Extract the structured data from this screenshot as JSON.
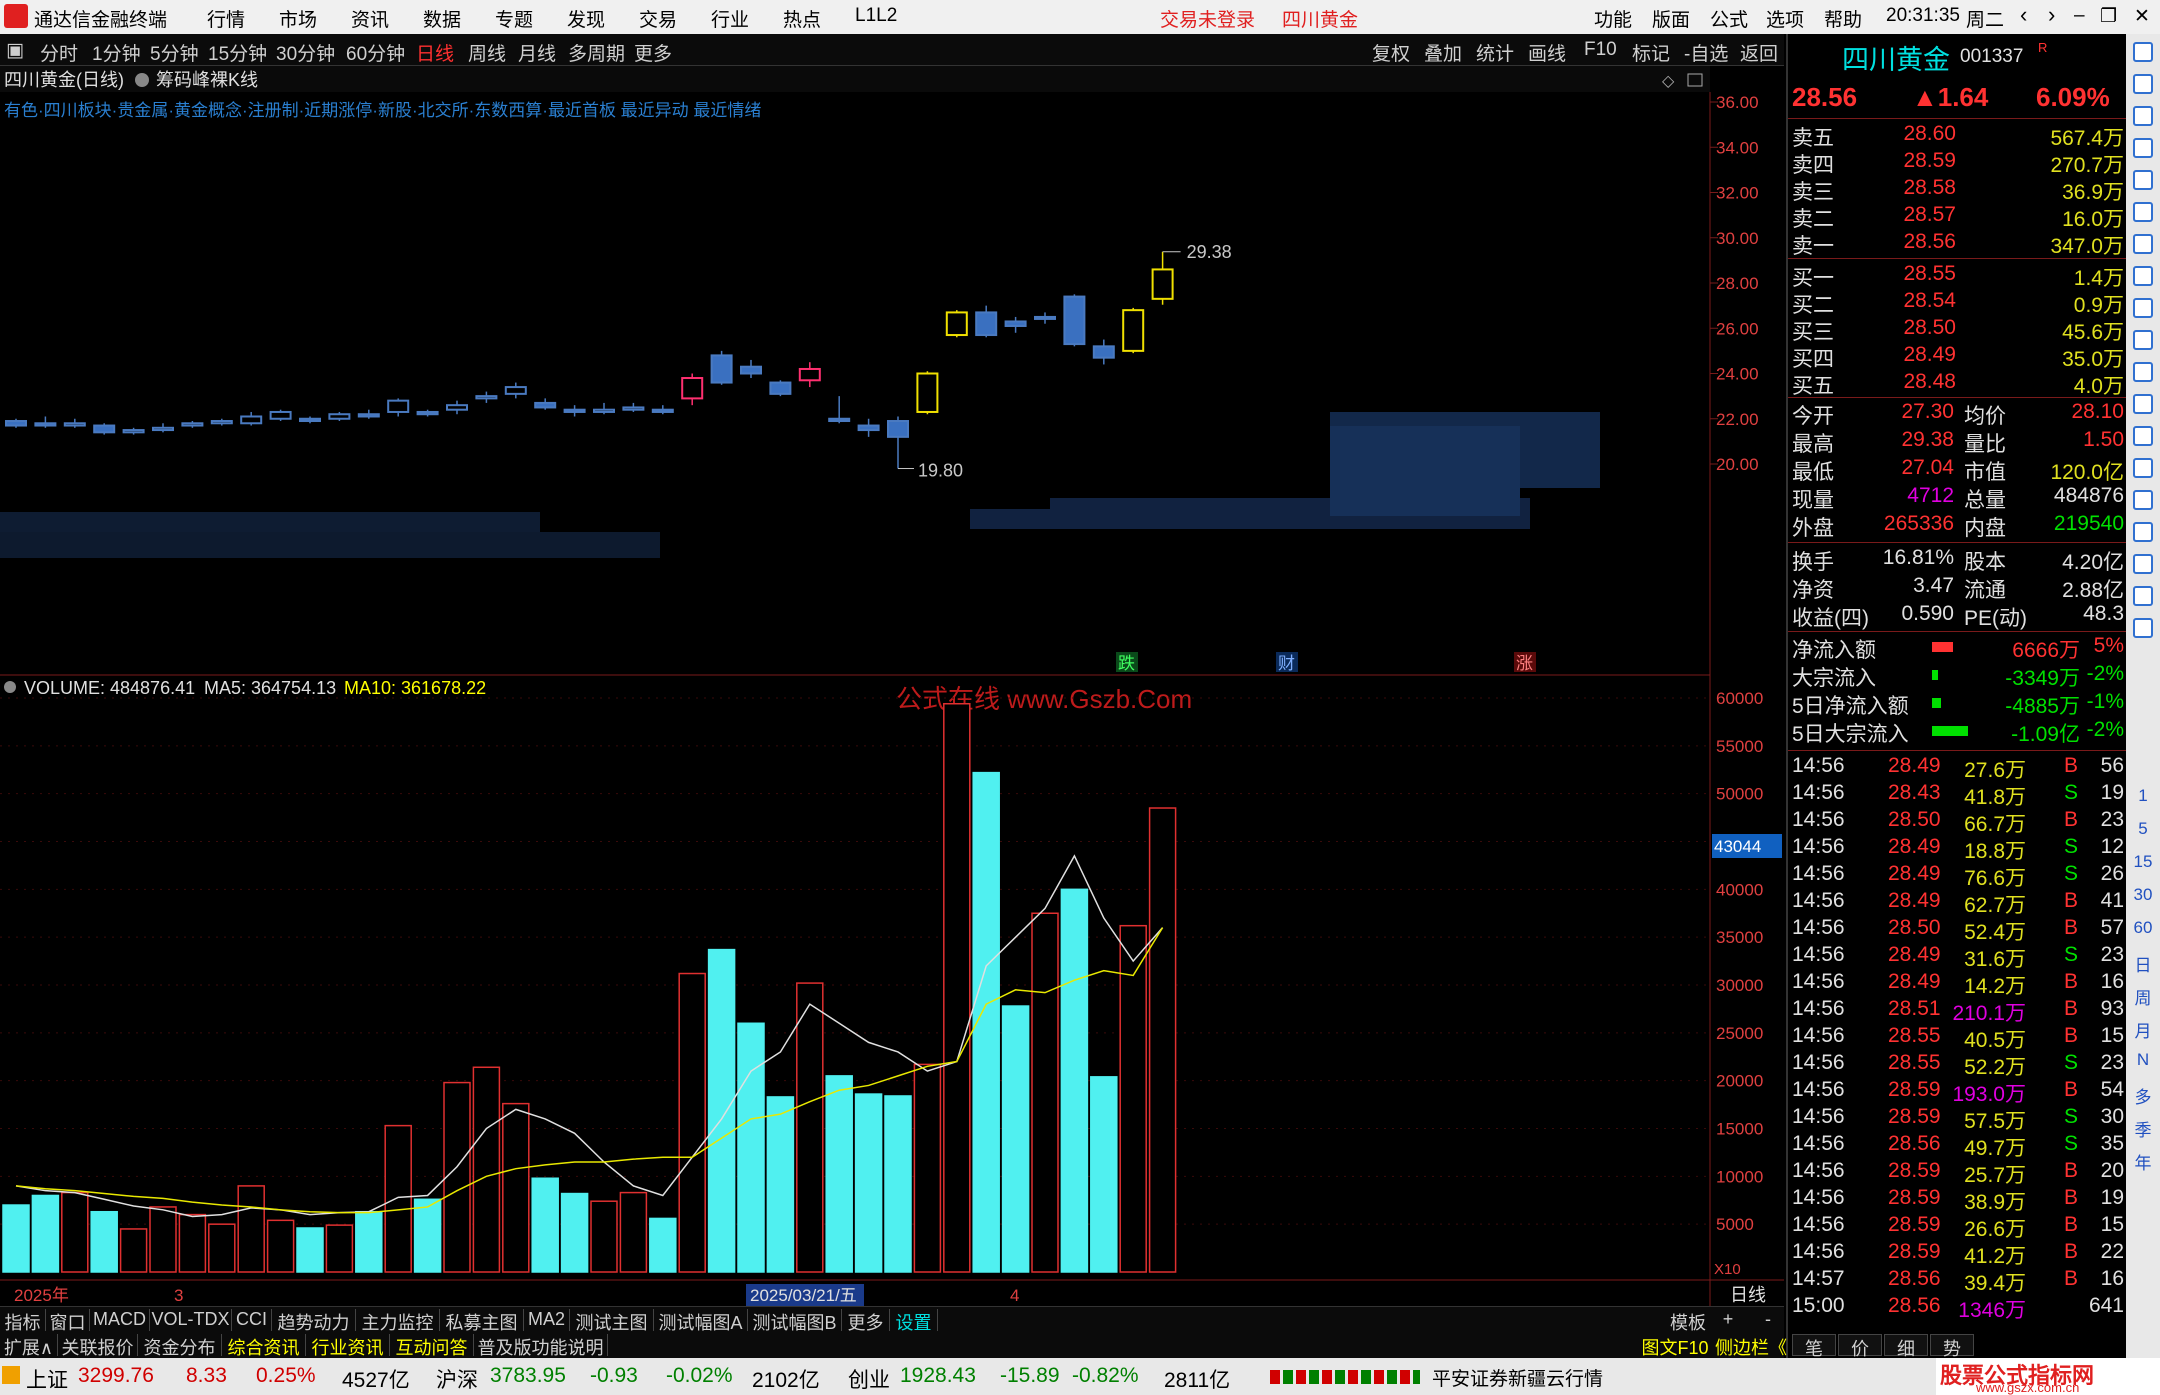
{
  "menubar": {
    "app_title": "通达信金融终端",
    "items": [
      "行情",
      "市场",
      "资讯",
      "数据",
      "专题",
      "发现",
      "交易",
      "行业",
      "热点",
      "L1L2"
    ],
    "login_status": "交易未登录",
    "stock_name": "四川黄金",
    "right_items": [
      "功能",
      "版面",
      "公式",
      "选项",
      "帮助"
    ],
    "time": "20:31:35",
    "weekday": "周二"
  },
  "toolbar": {
    "periods": [
      "分时",
      "1分钟",
      "5分钟",
      "15分钟",
      "30分钟",
      "60分钟",
      "日线",
      "周线",
      "月线",
      "多周期",
      "更多"
    ],
    "active_period": "日线",
    "right_buttons": [
      "复权",
      "叠加",
      "统计",
      "画线",
      "F10",
      "标记",
      "-自选",
      "返回"
    ]
  },
  "chart_header": {
    "title": "四川黄金(日线)",
    "indicator": "筹码峰裸K线",
    "info_line": "有色·四川板块·贵金属·黄金概念·注册制·近期涨停·新股·北交所·东数西算·最近首板 最近异动 最近情绪"
  },
  "price_axis": [
    "36.00",
    "34.00",
    "32.00",
    "30.00",
    "28.00",
    "26.00",
    "24.00",
    "22.00",
    "20.00"
  ],
  "annotations": {
    "high_label": "29.38",
    "low_label": "19.80",
    "marks": [
      "跌",
      "财",
      "涨"
    ]
  },
  "volume_header": {
    "volume": "VOLUME: 484876.41",
    "ma5": "MA5: 364754.13",
    "ma10": "MA10: 361678.22"
  },
  "volume_axis": [
    "60000",
    "55000",
    "50000",
    "45000",
    "40000",
    "35000",
    "30000",
    "25000",
    "20000",
    "15000",
    "10000",
    "5000"
  ],
  "volume_marker": "43044",
  "volume_unit": "X10",
  "watermark": "公式在线 www.Gszb.Com",
  "xaxis": {
    "year": "2025年",
    "month3": "3",
    "date_box": "2025/03/21/五",
    "month4": "4",
    "period_label": "日线"
  },
  "chart_data": {
    "type": "candlestick+bar",
    "candles": [
      {
        "o": 21.9,
        "c": 21.7,
        "h": 22.0,
        "l": 21.6
      },
      {
        "o": 21.8,
        "c": 21.7,
        "h": 22.1,
        "l": 21.6
      },
      {
        "o": 21.7,
        "c": 21.8,
        "h": 22.0,
        "l": 21.6
      },
      {
        "o": 21.7,
        "c": 21.4,
        "h": 21.8,
        "l": 21.3
      },
      {
        "o": 21.4,
        "c": 21.5,
        "h": 21.6,
        "l": 21.3
      },
      {
        "o": 21.5,
        "c": 21.6,
        "h": 21.8,
        "l": 21.4
      },
      {
        "o": 21.7,
        "c": 21.8,
        "h": 21.9,
        "l": 21.6
      },
      {
        "o": 21.8,
        "c": 21.9,
        "h": 22.0,
        "l": 21.7
      },
      {
        "o": 21.8,
        "c": 22.1,
        "h": 22.3,
        "l": 21.7
      },
      {
        "o": 22.0,
        "c": 22.3,
        "h": 22.4,
        "l": 21.9
      },
      {
        "o": 22.0,
        "c": 21.9,
        "h": 22.1,
        "l": 21.8
      },
      {
        "o": 22.0,
        "c": 22.2,
        "h": 22.3,
        "l": 21.9
      },
      {
        "o": 22.2,
        "c": 22.1,
        "h": 22.4,
        "l": 22.0
      },
      {
        "o": 22.3,
        "c": 22.8,
        "h": 22.9,
        "l": 22.1
      },
      {
        "o": 22.3,
        "c": 22.2,
        "h": 22.4,
        "l": 22.1
      },
      {
        "o": 22.4,
        "c": 22.6,
        "h": 22.8,
        "l": 22.2
      },
      {
        "o": 22.9,
        "c": 23.0,
        "h": 23.2,
        "l": 22.7
      },
      {
        "o": 23.1,
        "c": 23.4,
        "h": 23.6,
        "l": 22.9
      },
      {
        "o": 22.7,
        "c": 22.5,
        "h": 22.9,
        "l": 22.4
      },
      {
        "o": 22.4,
        "c": 22.3,
        "h": 22.6,
        "l": 22.1
      },
      {
        "o": 22.3,
        "c": 22.4,
        "h": 22.7,
        "l": 22.2
      },
      {
        "o": 22.4,
        "c": 22.5,
        "h": 22.7,
        "l": 22.3
      },
      {
        "o": 22.4,
        "c": 22.3,
        "h": 22.6,
        "l": 22.2
      },
      {
        "o": 22.9,
        "c": 23.8,
        "h": 24.0,
        "l": 22.6
      },
      {
        "o": 24.8,
        "c": 23.6,
        "h": 25.0,
        "l": 23.5
      },
      {
        "o": 24.3,
        "c": 24.0,
        "h": 24.6,
        "l": 23.8
      },
      {
        "o": 23.6,
        "c": 23.1,
        "h": 23.7,
        "l": 23.0
      },
      {
        "o": 23.7,
        "c": 24.2,
        "h": 24.5,
        "l": 23.4
      },
      {
        "o": 22.0,
        "c": 21.9,
        "h": 23.0,
        "l": 21.8
      },
      {
        "o": 21.7,
        "c": 21.5,
        "h": 22.0,
        "l": 21.2
      },
      {
        "o": 21.9,
        "c": 21.2,
        "h": 22.1,
        "l": 19.8
      },
      {
        "o": 22.3,
        "c": 24.0,
        "h": 24.1,
        "l": 22.2
      },
      {
        "o": 25.7,
        "c": 26.7,
        "h": 26.8,
        "l": 25.6
      },
      {
        "o": 26.7,
        "c": 25.7,
        "h": 27.0,
        "l": 25.6
      },
      {
        "o": 26.3,
        "c": 26.1,
        "h": 26.5,
        "l": 25.8
      },
      {
        "o": 26.5,
        "c": 26.5,
        "h": 26.7,
        "l": 26.2
      },
      {
        "o": 27.4,
        "c": 25.3,
        "h": 27.5,
        "l": 25.2
      },
      {
        "o": 25.2,
        "c": 24.7,
        "h": 25.5,
        "l": 24.4
      },
      {
        "o": 25.0,
        "c": 26.8,
        "h": 26.9,
        "l": 24.9
      },
      {
        "o": 27.3,
        "c": 28.6,
        "h": 29.38,
        "l": 27.04
      }
    ],
    "volumes": [
      7000,
      8000,
      8300,
      6300,
      4500,
      6800,
      6000,
      5000,
      9000,
      5400,
      4600,
      4900,
      6300,
      15300,
      7600,
      19800,
      21400,
      17600,
      9800,
      8200,
      7400,
      8300,
      5600,
      31200,
      33700,
      26000,
      18300,
      30200,
      20500,
      18600,
      18400,
      21700,
      59400,
      52200,
      27800,
      37500,
      40000,
      20400,
      36200,
      48500
    ],
    "ma5": [
      9000,
      8500,
      8300,
      7600,
      6900,
      6500,
      5800,
      6000,
      6700,
      6500,
      6000,
      6200,
      6300,
      7800,
      8000,
      11000,
      15000,
      17000,
      16000,
      14500,
      11500,
      9000,
      8000,
      12000,
      16000,
      21000,
      23000,
      28000,
      26000,
      24000,
      23000,
      21000,
      22000,
      32000,
      35000,
      38000,
      43500,
      37000,
      32500,
      36000
    ],
    "ma10": [
      9000,
      8700,
      8500,
      8200,
      7900,
      7700,
      7300,
      7000,
      6800,
      6500,
      6300,
      6200,
      6200,
      6500,
      6800,
      8500,
      10000,
      10800,
      11200,
      11500,
      11500,
      11800,
      12000,
      12000,
      14000,
      16000,
      16500,
      17800,
      19000,
      19500,
      20500,
      21500,
      22000,
      28000,
      29500,
      29200,
      30500,
      31500,
      31000,
      36000
    ],
    "ylim_price": [
      19.5,
      37.0
    ],
    "ylim_volume": [
      0,
      62000
    ]
  },
  "quote": {
    "name": "四川黄金",
    "code": "001337",
    "price": "28.56",
    "change": "▲1.64",
    "pct": "6.09%",
    "sells": [
      {
        "label": "卖五",
        "price": "28.60",
        "vol": "567.4万"
      },
      {
        "label": "卖四",
        "price": "28.59",
        "vol": "270.7万"
      },
      {
        "label": "卖三",
        "price": "28.58",
        "vol": "36.9万"
      },
      {
        "label": "卖二",
        "price": "28.57",
        "vol": "16.0万"
      },
      {
        "label": "卖一",
        "price": "28.56",
        "vol": "347.0万"
      }
    ],
    "buys": [
      {
        "label": "买一",
        "price": "28.55",
        "vol": "1.4万"
      },
      {
        "label": "买二",
        "price": "28.54",
        "vol": "0.9万"
      },
      {
        "label": "买三",
        "price": "28.50",
        "vol": "45.6万"
      },
      {
        "label": "买四",
        "price": "28.49",
        "vol": "35.0万"
      },
      {
        "label": "买五",
        "price": "28.48",
        "vol": "4.0万"
      }
    ],
    "stats": [
      {
        "l1": "今开",
        "v1": "27.30",
        "l2": "均价",
        "v2": "28.10"
      },
      {
        "l1": "最高",
        "v1": "29.38",
        "l2": "量比",
        "v2": "1.50"
      },
      {
        "l1": "最低",
        "v1": "27.04",
        "l2": "市值",
        "v2": "120.0亿"
      },
      {
        "l1": "现量",
        "v1": "4712",
        "l2": "总量",
        "v2": "484876"
      },
      {
        "l1": "外盘",
        "v1": "265336",
        "l2": "内盘",
        "v2": "219540"
      }
    ],
    "stats2": [
      {
        "l1": "换手",
        "v1": "16.81%",
        "l2": "股本",
        "v2": "4.20亿"
      },
      {
        "l1": "净资",
        "v1": "3.47",
        "l2": "流通",
        "v2": "2.88亿"
      },
      {
        "l1": "收益(四)",
        "v1": "0.590",
        "l2": "PE(动)",
        "v2": "48.3"
      }
    ],
    "flows": [
      {
        "label": "净流入额",
        "value": "6666万",
        "pct": "5%",
        "bar": 0.35,
        "color": "#ff3232"
      },
      {
        "label": "大宗流入",
        "value": "-3349万",
        "pct": "-2%",
        "bar": 0.1,
        "color": "#00e000"
      },
      {
        "label": "5日净流入额",
        "value": "-4885万",
        "pct": "-1%",
        "bar": 0.15,
        "color": "#00e000"
      },
      {
        "label": "5日大宗流入",
        "value": "-1.09亿",
        "pct": "-2%",
        "bar": 0.6,
        "color": "#00e000"
      }
    ],
    "ticks": [
      {
        "t": "14:56",
        "p": "28.49",
        "v": "27.6万",
        "bs": "B",
        "n": "56"
      },
      {
        "t": "14:56",
        "p": "28.43",
        "v": "41.8万",
        "bs": "S",
        "n": "19"
      },
      {
        "t": "14:56",
        "p": "28.50",
        "v": "66.7万",
        "bs": "B",
        "n": "23"
      },
      {
        "t": "14:56",
        "p": "28.49",
        "v": "18.8万",
        "bs": "S",
        "n": "12"
      },
      {
        "t": "14:56",
        "p": "28.49",
        "v": "76.6万",
        "bs": "S",
        "n": "26"
      },
      {
        "t": "14:56",
        "p": "28.49",
        "v": "62.7万",
        "bs": "B",
        "n": "41"
      },
      {
        "t": "14:56",
        "p": "28.50",
        "v": "52.4万",
        "bs": "B",
        "n": "57"
      },
      {
        "t": "14:56",
        "p": "28.49",
        "v": "31.6万",
        "bs": "S",
        "n": "23"
      },
      {
        "t": "14:56",
        "p": "28.49",
        "v": "14.2万",
        "bs": "B",
        "n": "16"
      },
      {
        "t": "14:56",
        "p": "28.51",
        "v": "210.1万",
        "bs": "B",
        "n": "93"
      },
      {
        "t": "14:56",
        "p": "28.55",
        "v": "40.5万",
        "bs": "B",
        "n": "15"
      },
      {
        "t": "14:56",
        "p": "28.55",
        "v": "52.2万",
        "bs": "S",
        "n": "23"
      },
      {
        "t": "14:56",
        "p": "28.59",
        "v": "193.0万",
        "bs": "B",
        "n": "54"
      },
      {
        "t": "14:56",
        "p": "28.59",
        "v": "57.5万",
        "bs": "S",
        "n": "30"
      },
      {
        "t": "14:56",
        "p": "28.56",
        "v": "49.7万",
        "bs": "S",
        "n": "35"
      },
      {
        "t": "14:56",
        "p": "28.59",
        "v": "25.7万",
        "bs": "B",
        "n": "20"
      },
      {
        "t": "14:56",
        "p": "28.59",
        "v": "38.9万",
        "bs": "B",
        "n": "19"
      },
      {
        "t": "14:56",
        "p": "28.59",
        "v": "26.6万",
        "bs": "B",
        "n": "15"
      },
      {
        "t": "14:56",
        "p": "28.59",
        "v": "41.2万",
        "bs": "B",
        "n": "22"
      },
      {
        "t": "14:57",
        "p": "28.56",
        "v": "39.4万",
        "bs": "B",
        "n": "16"
      },
      {
        "t": "15:00",
        "p": "28.56",
        "v": "1346万",
        "bs": "",
        "n": "641"
      }
    ]
  },
  "rightbar_labels": [
    "1",
    "5",
    "15",
    "30",
    "60",
    "日",
    "周",
    "月",
    "N",
    "多",
    "季",
    "年"
  ],
  "bottomtabs": [
    "指标",
    "窗口",
    "MACD",
    "VOL-TDX",
    "CCI",
    "趋势动力",
    "主力监控",
    "私募主图",
    "MA2",
    "测试主图",
    "测试幅图A",
    "测试幅图B",
    "更多",
    "设置"
  ],
  "bottomtabs_right": [
    "模板",
    "+",
    "-"
  ],
  "bottomtabs2": [
    "扩展∧",
    "关联报价",
    "资金分布",
    "综合资讯",
    "行业资讯",
    "互动问答",
    "普及版功能说明"
  ],
  "bottomtabs2_right": [
    "图文F10",
    "侧边栏《",
    "笔",
    "价",
    "细",
    "势"
  ],
  "statusbar": {
    "sh_label": "上证",
    "sh_val": "3299.76",
    "sh_chg": "8.33",
    "sh_pct": "0.25%",
    "sh_amt": "4527亿",
    "sz_label": "沪深",
    "sz_val": "3783.95",
    "sz_chg": "-0.93",
    "sz_pct": "-0.02%",
    "sz_amt": "2102亿",
    "cy_label": "创业",
    "cy_val": "1928.43",
    "cy_chg": "-15.89",
    "cy_pct": "-0.82%",
    "cy_amt": "2811亿",
    "broker": "平安证券新疆云行情",
    "brand": "股票公式指标网",
    "brand_url": "www.gszx.com.cn"
  }
}
